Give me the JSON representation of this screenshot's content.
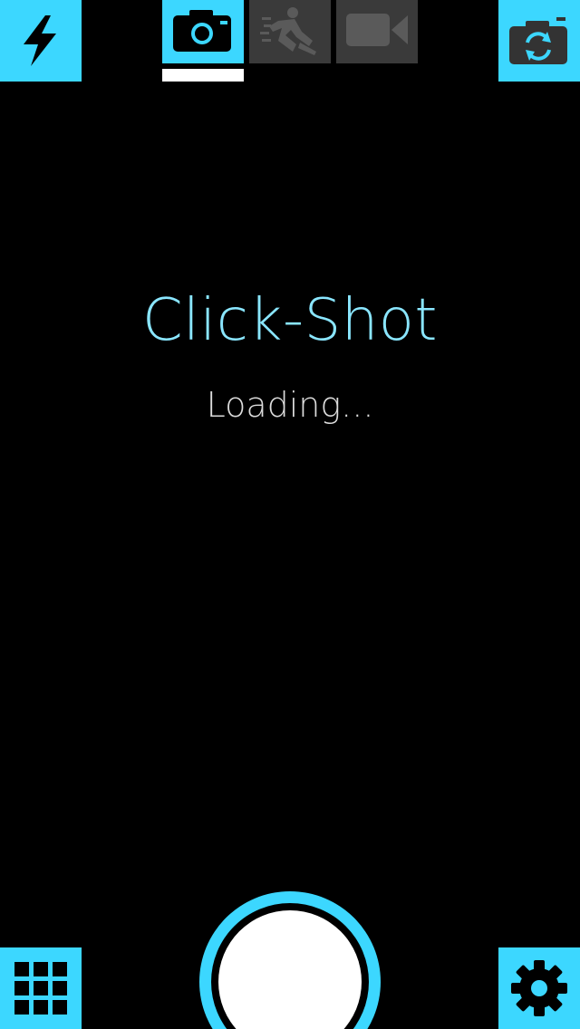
{
  "app": {
    "title": "Click-Shot",
    "status": "Loading..."
  },
  "colors": {
    "accent": "#3cd7ff",
    "title": "#8ae6ff",
    "loading": "#dcdcdc",
    "tab_inactive": "#3a3a3a",
    "tab_icon_inactive": "#5a5a5a",
    "background": "#000000",
    "shutter_fill": "#ffffff"
  },
  "top_bar": {
    "flash_icon": "lightning-bolt-icon",
    "switch_camera_icon": "camera-switch-icon",
    "mode_tabs": [
      {
        "name": "photo",
        "icon": "camera-icon",
        "active": true
      },
      {
        "name": "burst",
        "icon": "running-person-icon",
        "active": false
      },
      {
        "name": "video",
        "icon": "video-camera-icon",
        "active": false
      }
    ]
  },
  "bottom_bar": {
    "gallery_icon": "grid-icon",
    "settings_icon": "gear-icon",
    "shutter_icon": "shutter-button"
  }
}
